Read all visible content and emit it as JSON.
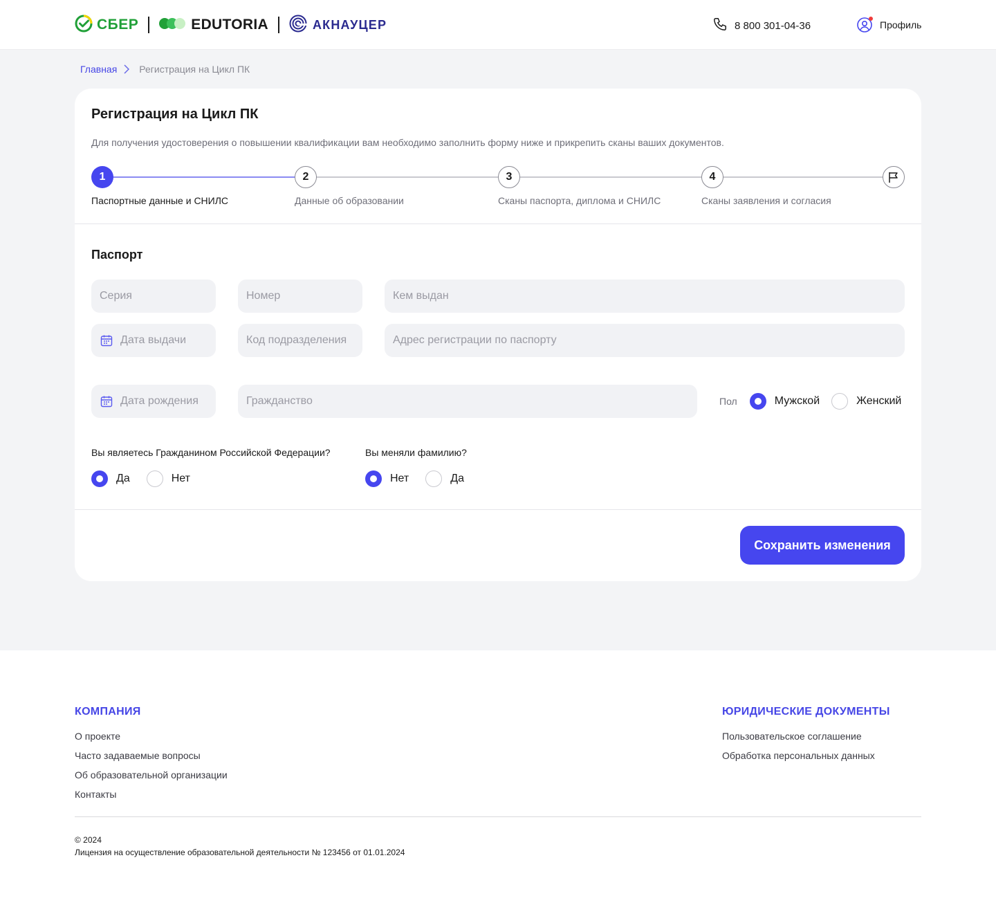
{
  "header": {
    "logo_sber": "СБЕР",
    "logo_edutoria": "EDUTORIA",
    "logo_aknaucer": "АКНАУЦЕР",
    "phone": "8 800 301-04-36",
    "profile_label": "Профиль"
  },
  "breadcrumb": {
    "home": "Главная",
    "current": "Регистрация на Цикл ПК"
  },
  "page": {
    "title": "Регистрация на Цикл ПК",
    "description": "Для получения удостоверения о повышении квалификации вам необходимо заполнить форму ниже и прикрепить сканы ваших документов."
  },
  "stepper": {
    "steps": [
      {
        "number": "1",
        "label": "Паспортные данные и СНИЛС",
        "active": true
      },
      {
        "number": "2",
        "label": "Данные об образовании",
        "active": false
      },
      {
        "number": "3",
        "label": "Сканы паспорта, диплома и СНИЛС",
        "active": false
      },
      {
        "number": "4",
        "label": "Сканы заявления и согласия",
        "active": false
      }
    ],
    "finish_icon": "flag-icon"
  },
  "passport": {
    "section_title": "Паспорт",
    "series_placeholder": "Серия",
    "number_placeholder": "Номер",
    "issued_by_placeholder": "Кем выдан",
    "issue_date_placeholder": "Дата выдачи",
    "division_code_placeholder": "Код подразделения",
    "address_placeholder": "Адрес регистрации по паспорту",
    "birth_date_placeholder": "Дата рождения",
    "citizenship_placeholder": "Гражданство",
    "gender": {
      "label": "Пол",
      "options": [
        "Мужской",
        "Женский"
      ],
      "selected": "Мужской"
    },
    "rf_citizen": {
      "question": "Вы являетесь Гражданином Российской Федерации?",
      "options": [
        "Да",
        "Нет"
      ],
      "selected": "Да"
    },
    "changed_surname": {
      "question": "Вы меняли фамилию?",
      "options": [
        "Нет",
        "Да"
      ],
      "selected": "Нет"
    }
  },
  "actions": {
    "save_label": "Сохранить изменения"
  },
  "footer": {
    "company": {
      "heading": "КОМПАНИЯ",
      "links": [
        "О проекте",
        "Часто задаваемые вопросы",
        "Об образовательной организации",
        "Контакты"
      ]
    },
    "legal": {
      "heading": "ЮРИДИЧЕСКИЕ ДОКУМЕНТЫ",
      "links": [
        "Пользовательское соглашение",
        "Обработка персональных данных"
      ]
    },
    "copyright": "© 2024",
    "license": "Лицензия на осуществление образовательной деятельности № 123456 от 01.01.2024"
  },
  "colors": {
    "accent": "#4646EF",
    "sber_green": "#21A038",
    "page_background": "#F3F4F6",
    "field_background": "#F1F2F5"
  }
}
